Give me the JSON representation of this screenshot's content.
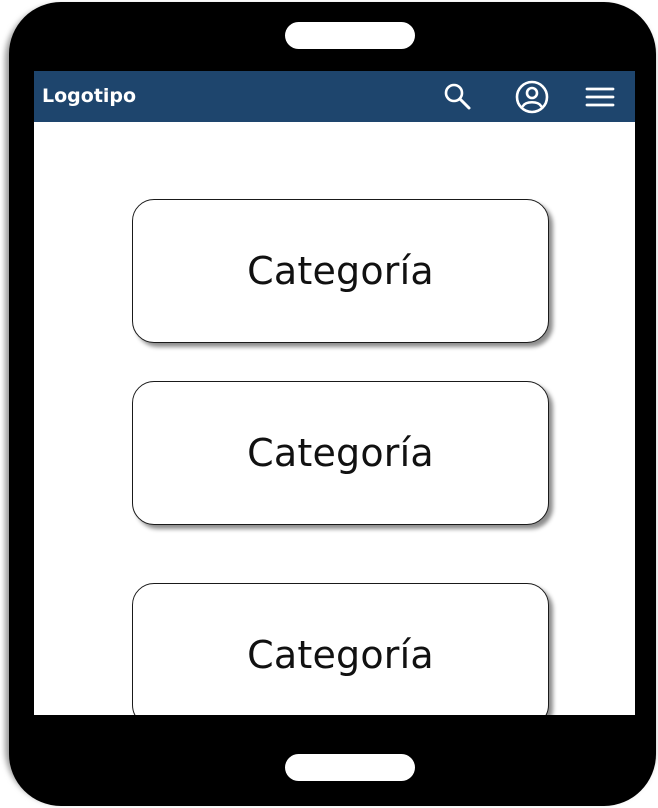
{
  "app": {
    "logo_text": "Logotipo"
  },
  "header": {
    "background_color": "#1e456d",
    "icons": [
      "search-icon",
      "account-icon",
      "menu-icon"
    ]
  },
  "categories": [
    {
      "label": "Categoría"
    },
    {
      "label": "Categoría"
    },
    {
      "label": "Categoría"
    }
  ]
}
